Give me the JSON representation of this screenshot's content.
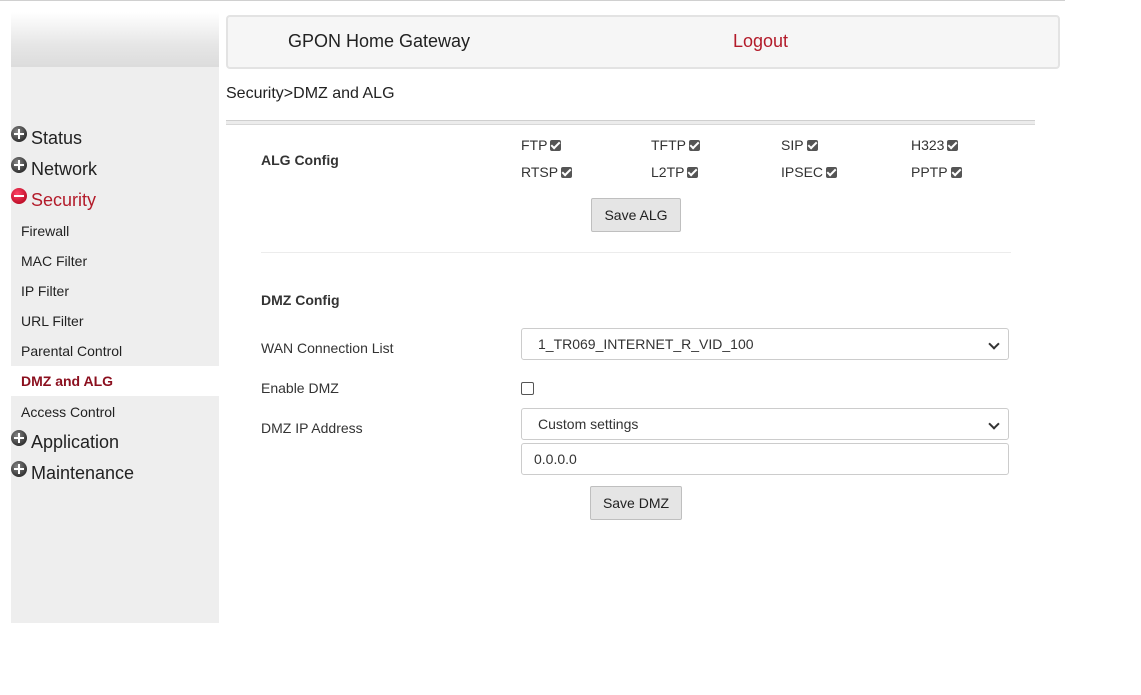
{
  "header": {
    "title": "GPON Home Gateway",
    "logout": "Logout"
  },
  "breadcrumb": "Security>DMZ and ALG",
  "sidebar": {
    "main_items": [
      {
        "label": "Status",
        "state": "collapsed"
      },
      {
        "label": "Network",
        "state": "collapsed"
      },
      {
        "label": "Security",
        "state": "expanded"
      },
      {
        "label": "Application",
        "state": "collapsed"
      },
      {
        "label": "Maintenance",
        "state": "collapsed"
      }
    ],
    "security_sub_items": [
      "Firewall",
      "MAC Filter",
      "IP Filter",
      "URL Filter",
      "Parental Control",
      "DMZ and ALG",
      "Access Control"
    ],
    "active_sub_item": "DMZ and ALG"
  },
  "alg": {
    "section_label": "ALG Config",
    "items": [
      {
        "label": "FTP",
        "checked": true
      },
      {
        "label": "TFTP",
        "checked": true
      },
      {
        "label": "SIP",
        "checked": true
      },
      {
        "label": "H323",
        "checked": true
      },
      {
        "label": "RTSP",
        "checked": true
      },
      {
        "label": "L2TP",
        "checked": true
      },
      {
        "label": "IPSEC",
        "checked": true
      },
      {
        "label": "PPTP",
        "checked": true
      }
    ],
    "save_label": "Save ALG"
  },
  "dmz": {
    "section_label": "DMZ Config",
    "wan_label": "WAN Connection List",
    "wan_value": "1_TR069_INTERNET_R_VID_100",
    "enable_label": "Enable DMZ",
    "enable_checked": false,
    "ip_label": "DMZ IP Address",
    "ip_mode_value": "Custom settings",
    "ip_value": "0.0.0.0",
    "save_label": "Save DMZ"
  },
  "colors": {
    "accent": "#b31b2a",
    "active_sub": "#8b0f1e",
    "sidebar_bg": "#eeeeee"
  }
}
